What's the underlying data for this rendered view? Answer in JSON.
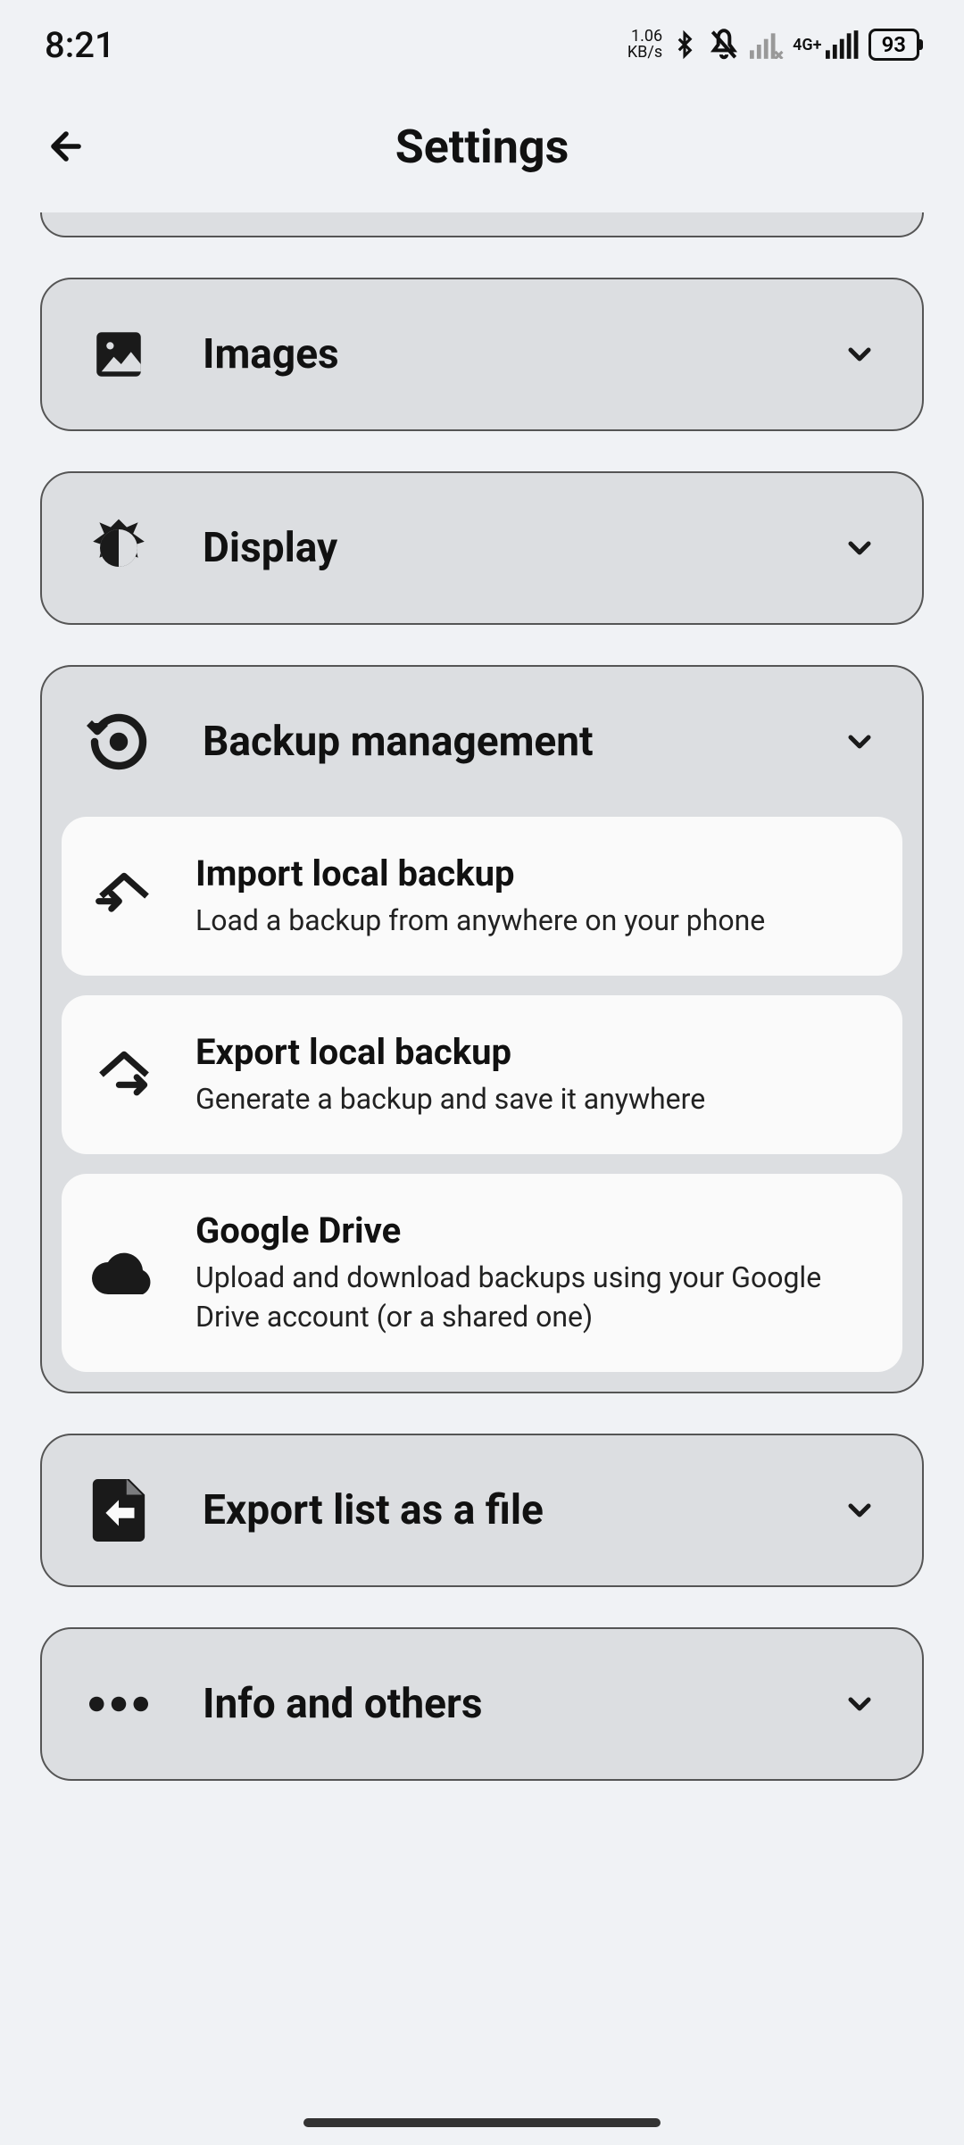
{
  "statusBar": {
    "time": "8:21",
    "netSpeedTop": "1.06",
    "netSpeedBottom": "KB/s",
    "netType": "4G+",
    "battery": "93"
  },
  "header": {
    "title": "Settings"
  },
  "sections": {
    "images": {
      "title": "Images"
    },
    "display": {
      "title": "Display"
    },
    "backup": {
      "title": "Backup management",
      "items": {
        "import": {
          "title": "Import local backup",
          "desc": "Load a backup from anywhere on your phone"
        },
        "export": {
          "title": "Export local backup",
          "desc": "Generate a backup and save it anywhere"
        },
        "drive": {
          "title": "Google Drive",
          "desc": "Upload and download backups using your Google Drive account (or a shared one)"
        }
      }
    },
    "exportFile": {
      "title": "Export list as a file"
    },
    "info": {
      "title": "Info and others"
    }
  }
}
